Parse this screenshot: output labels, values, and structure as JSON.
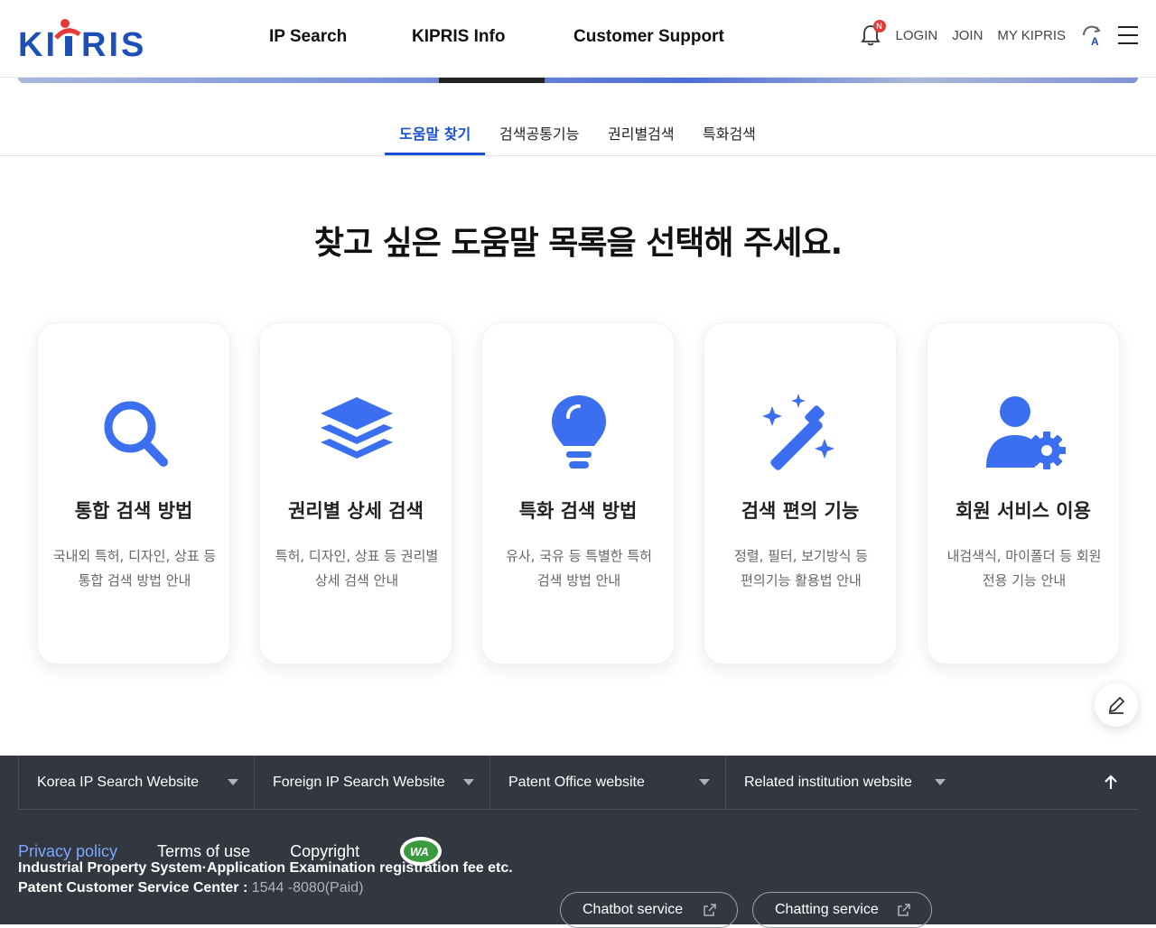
{
  "header": {
    "logo_text": "KIPRIS",
    "nav": [
      "IP Search",
      "KIPRIS Info",
      "Customer Support"
    ],
    "notification_badge": "N",
    "util_links": [
      "LOGIN",
      "JOIN",
      "MY KIPRIS"
    ]
  },
  "tabs": [
    {
      "label": "도움말 찾기",
      "active": true
    },
    {
      "label": "검색공통기능",
      "active": false
    },
    {
      "label": "권리별검색",
      "active": false
    },
    {
      "label": "특화검색",
      "active": false
    }
  ],
  "headline": "찾고 싶은 도움말 목록을 선택해 주세요.",
  "cards": [
    {
      "icon": "search-icon",
      "title": "통합 검색 방법",
      "desc1": "국내외 특허, 디자인, 상표 등",
      "desc2": "통합 검색 방법 안내"
    },
    {
      "icon": "layers-icon",
      "title": "권리별 상세 검색",
      "desc1": "특허, 디자인, 상표 등 권리별",
      "desc2": "상세 검색 안내"
    },
    {
      "icon": "lightbulb-icon",
      "title": "특화 검색 방법",
      "desc1": "유사, 국유 등 특별한 특허",
      "desc2": "검색 방법 안내"
    },
    {
      "icon": "magic-wand-icon",
      "title": "검색 편의 기능",
      "desc1": "정렬, 필터, 보기방식 등",
      "desc2": "편의기능 활용법 안내"
    },
    {
      "icon": "user-gear-icon",
      "title": "회원 서비스 이용",
      "desc1": "내검색식, 마이폴더 등 회원",
      "desc2": "전용 기능 안내"
    }
  ],
  "footer": {
    "site_selects": [
      "Korea IP Search Website",
      "Foreign IP Search Website",
      "Patent Office website",
      "Related institution website"
    ],
    "links": [
      "Privacy policy",
      "Terms of use",
      "Copyright"
    ],
    "wa_mark_text": "WA",
    "info_line1": "Industrial Property System·Application Examination registration fee etc.",
    "info_line2_label": "Patent Customer Service Center : ",
    "info_line2_value": "1544 -8080(Paid)",
    "chatbot_label": "Chatbot service",
    "chatting_label": "Chatting service"
  },
  "colors": {
    "accent": "#1a4fd6",
    "icon_blue": "#3b6ff0",
    "footer_bg": "#333740",
    "privacy_link": "#7aa7ff"
  }
}
